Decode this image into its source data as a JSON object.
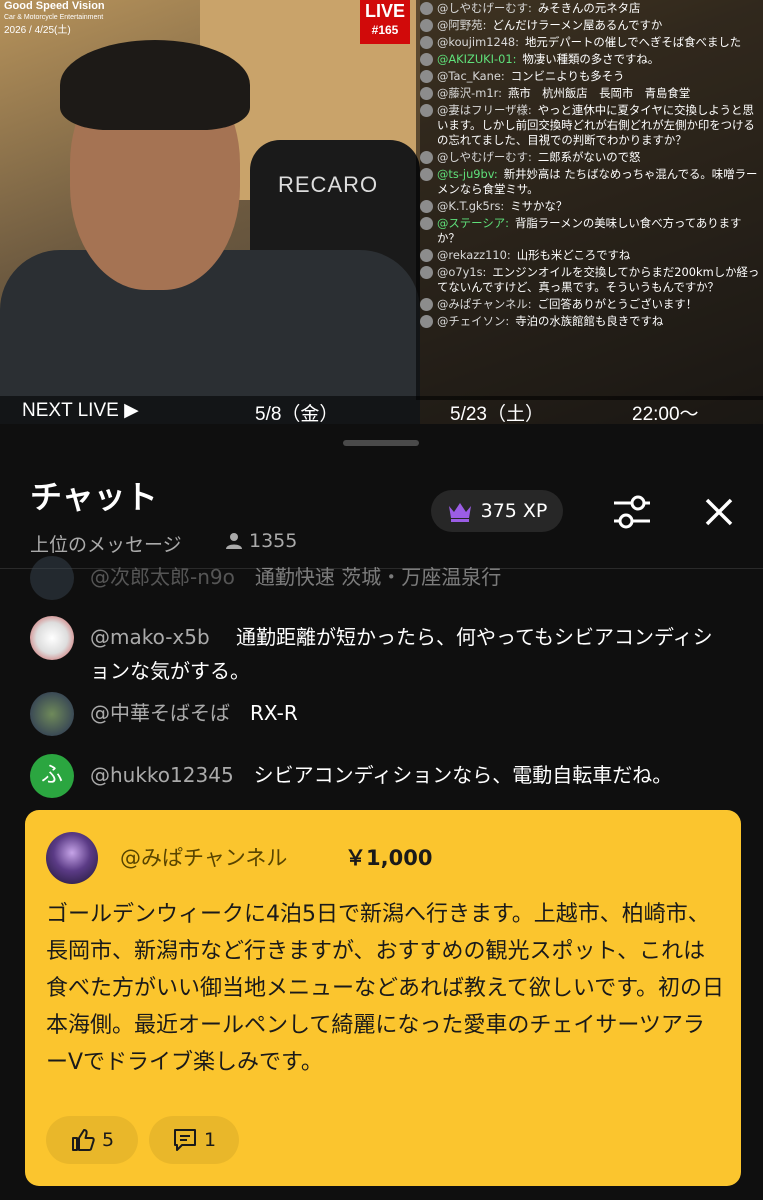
{
  "video": {
    "brand_name": "Good Speed Vision",
    "brand_sub": "Car & Motorcycle Entertainment",
    "date_stamp": "2026 / 4/25(土)",
    "live_label": "LIVE",
    "live_number": "#165",
    "seat_brand": "RECARO",
    "next_live_label": "NEXT LIVE ▶",
    "next_date_1": "5/8（金）",
    "next_date_2": "5/23（土）",
    "next_time": "22:00〜",
    "overlay_chat": [
      {
        "name": "@しやむげーむす:",
        "text": "みそきんの元ネタ店",
        "green": false
      },
      {
        "name": "@阿野苑:",
        "text": "どんだけラーメン屋あるんですか",
        "green": false
      },
      {
        "name": "@koujim1248:",
        "text": "地元デパートの催しでへぎそば食べました",
        "green": false
      },
      {
        "name": "@AKIZUKI-01:",
        "text": "物凄い種類の多さですね。",
        "green": true
      },
      {
        "name": "@Tac_Kane:",
        "text": "コンビニよりも多そう",
        "green": false
      },
      {
        "name": "@藤沢-m1r:",
        "text": "燕市　杭州飯店　長岡市　青島食堂",
        "green": false
      },
      {
        "name": "@妻はフリーザ様:",
        "text": "やっと連休中に夏タイヤに交換しようと思います。しかし前回交換時どれが右側どれが左側か印をつけるの忘れてました、目視での判断でわかりますか？",
        "green": false
      },
      {
        "name": "@しやむげーむす:",
        "text": "二郎系がないので怒",
        "green": false
      },
      {
        "name": "@ts-ju9bv:",
        "text": "新井妙高は たちばなめっちゃ混んでる。味噌ラーメンなら食堂ミサ。",
        "green": true
      },
      {
        "name": "@K.T.gk5rs:",
        "text": "ミサかな？",
        "green": false
      },
      {
        "name": "@ステーシア:",
        "text": "背脂ラーメンの美味しい食べ方ってありますか？",
        "green": true
      },
      {
        "name": "@rekazz110:",
        "text": "山形も米どころですね",
        "green": false
      },
      {
        "name": "@o7y1s:",
        "text": "エンジンオイルを交換してからまだ200kmしか経ってないんですけど、真っ黒です。そういうもんですか？",
        "green": false
      },
      {
        "name": "@みぱチャンネル:",
        "text": "ご回答ありがとうございます！",
        "green": false
      },
      {
        "name": "@チェイソン:",
        "text": "寺泊の水族館館も良きですね",
        "green": false
      }
    ]
  },
  "chat": {
    "title": "チャット",
    "subtitle": "上位のメッセージ",
    "viewer_count": "1355",
    "xp_label": "375 XP",
    "messages": [
      {
        "name": "@次郎太郎-n9o",
        "text": "通勤快速 茨城・万座温泉行"
      },
      {
        "name": "@mako-x5b",
        "text": "通勤距離が短かったら、何やってもシビアコンディションな気がする。"
      },
      {
        "name": "@中華そばそば",
        "text": "RX-R"
      },
      {
        "name": "@hukko12345",
        "text": "シビアコンディションなら、電動自転車だね。",
        "avatar_letter": "ふ"
      }
    ],
    "superchat": {
      "name": "@みぱチャンネル",
      "amount": "￥1,000",
      "body": "ゴールデンウィークに4泊5日で新潟へ行きます。上越市、柏崎市、長岡市、新潟市など行きますが、おすすめの観光スポット、これは食べた方がいい御当地メニューなどあれば教えて欲しいです。初の日本海側。最近オールペンして綺麗になった愛車のチェイサーツアラーVでドライブ楽しみです。",
      "like_count": "5",
      "reply_count": "1",
      "color": "#fbc52e"
    }
  }
}
